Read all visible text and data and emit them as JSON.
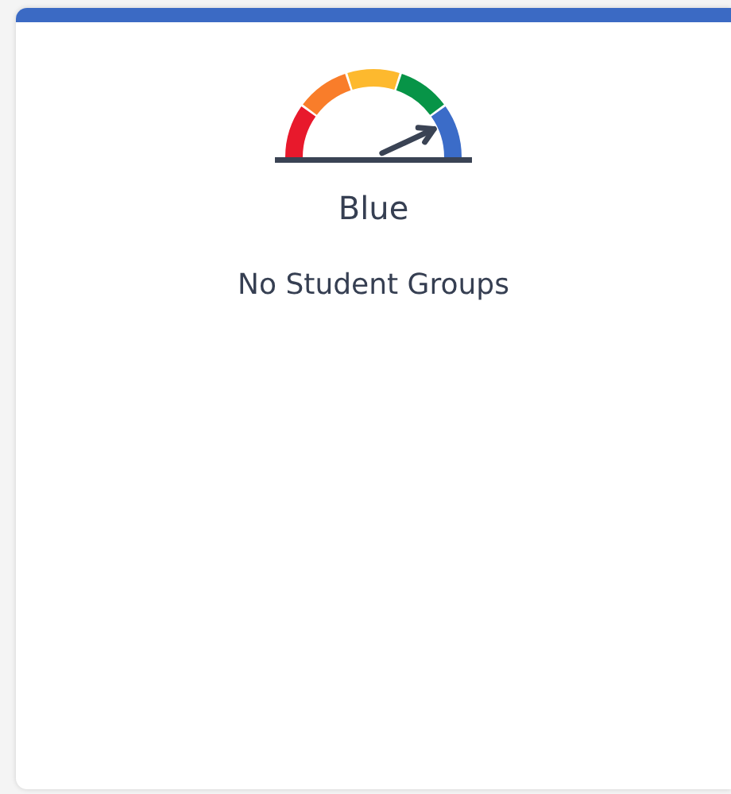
{
  "card": {
    "rating": "Blue",
    "student_groups": "No Student Groups"
  }
}
